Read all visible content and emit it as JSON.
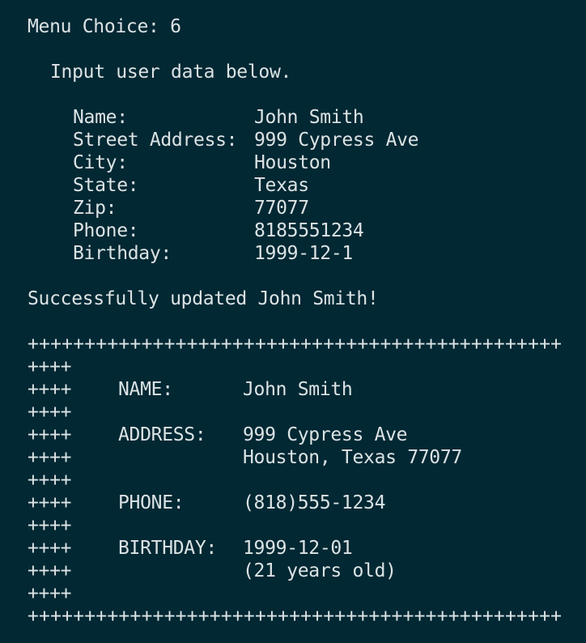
{
  "prompt": {
    "menu_choice": "Menu Choice: 6",
    "instruction": "Input user data below."
  },
  "form": [
    {
      "label": "Name:",
      "value": "John Smith"
    },
    {
      "label": "Street Address:",
      "value": "999 Cypress Ave"
    },
    {
      "label": "City:",
      "value": "Houston"
    },
    {
      "label": "State:",
      "value": "Texas"
    },
    {
      "label": "Zip:",
      "value": "77077"
    },
    {
      "label": "Phone:",
      "value": "8185551234"
    },
    {
      "label": "Birthday:",
      "value": "1999-12-1"
    }
  ],
  "message": "Successfully updated John Smith!",
  "card": {
    "border": "+++++++++++++++++++++++++++++++++++++++++++++++",
    "prefix": "++++",
    "name_label": "NAME:",
    "name_value": "John Smith",
    "address_label": "ADDRESS:",
    "address_line1": "999 Cypress Ave",
    "address_line2": "Houston, Texas 77077",
    "phone_label": "PHONE:",
    "phone_value": "(818)555-1234",
    "birthday_label": "BIRTHDAY:",
    "birthday_value": "1999-12-01",
    "age_text": "(21 years old)"
  }
}
